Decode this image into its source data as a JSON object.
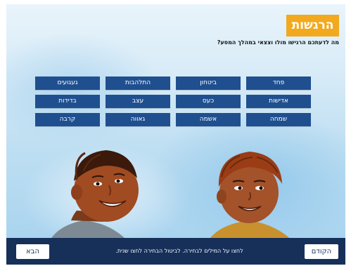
{
  "header": {
    "title": "הרגשות",
    "question": "מה לדעתכם הרגישו מולו וצצאי במהלך המסע?"
  },
  "words": [
    "פחד",
    "ביטחון",
    "התלהבות",
    "געגועים",
    "אדישות",
    "כעס",
    "עצב",
    "בדידות",
    "שמחה",
    "אשמה",
    "גאווה",
    "קרבה"
  ],
  "footer": {
    "instructions": "לחצו על המילים לבחירה. לביטול הבחירה לחצו שנית.",
    "next_label": "הבא",
    "prev_label": "הקודם"
  },
  "colors": {
    "title_bg": "#f2a91e",
    "word_bg": "#1f4f8f",
    "bar_bg": "#16305a"
  }
}
